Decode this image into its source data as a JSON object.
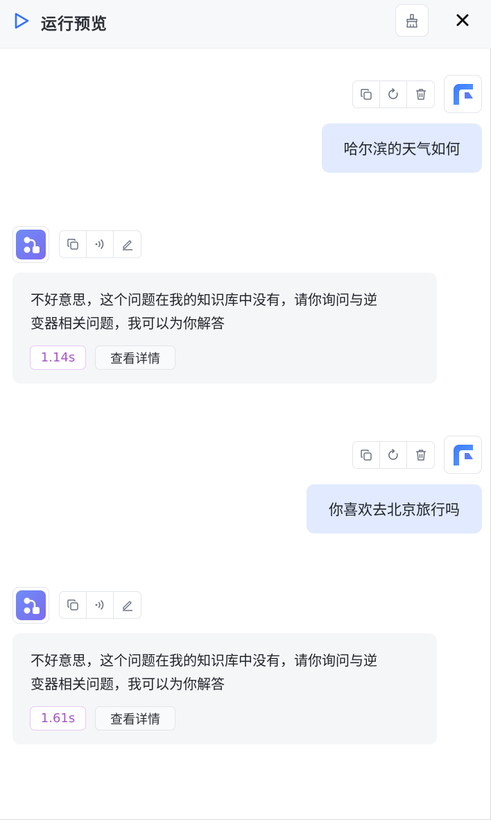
{
  "header": {
    "title": "运行预览",
    "play_icon": "play-icon",
    "clear_icon": "broom-icon",
    "close_icon": "close-icon"
  },
  "messages": [
    {
      "role": "user",
      "text": "哈尔滨的天气如何",
      "actions": [
        "copy-icon",
        "refresh-icon",
        "trash-icon"
      ]
    },
    {
      "role": "bot",
      "text": "不好意思，这个问题在我的知识库中没有，请你询问与逆变器相关问题，我可以为你解答",
      "line1": "不好意思，这个问题在我的知识库中没有，请你询问与逆",
      "line2": "变器相关问题，我可以为你解答",
      "time": "1.14s",
      "detail_label": "查看详情",
      "actions": [
        "copy-icon",
        "speaker-icon",
        "edit-icon"
      ]
    },
    {
      "role": "user",
      "text": "你喜欢去北京旅行吗",
      "actions": [
        "copy-icon",
        "refresh-icon",
        "trash-icon"
      ]
    },
    {
      "role": "bot",
      "text": "不好意思，这个问题在我的知识库中没有，请你询问与逆变器相关问题，我可以为你解答",
      "line1": "不好意思，这个问题在我的知识库中没有，请你询问与逆",
      "line2": "变器相关问题，我可以为你解答",
      "time": "1.61s",
      "detail_label": "查看详情",
      "actions": [
        "copy-icon",
        "speaker-icon",
        "edit-icon"
      ]
    }
  ],
  "colors": {
    "accent": "#3370ff",
    "user_bubble": "#e1eaff",
    "bot_card": "#f5f6f8",
    "time_badge": "#a855c7"
  }
}
